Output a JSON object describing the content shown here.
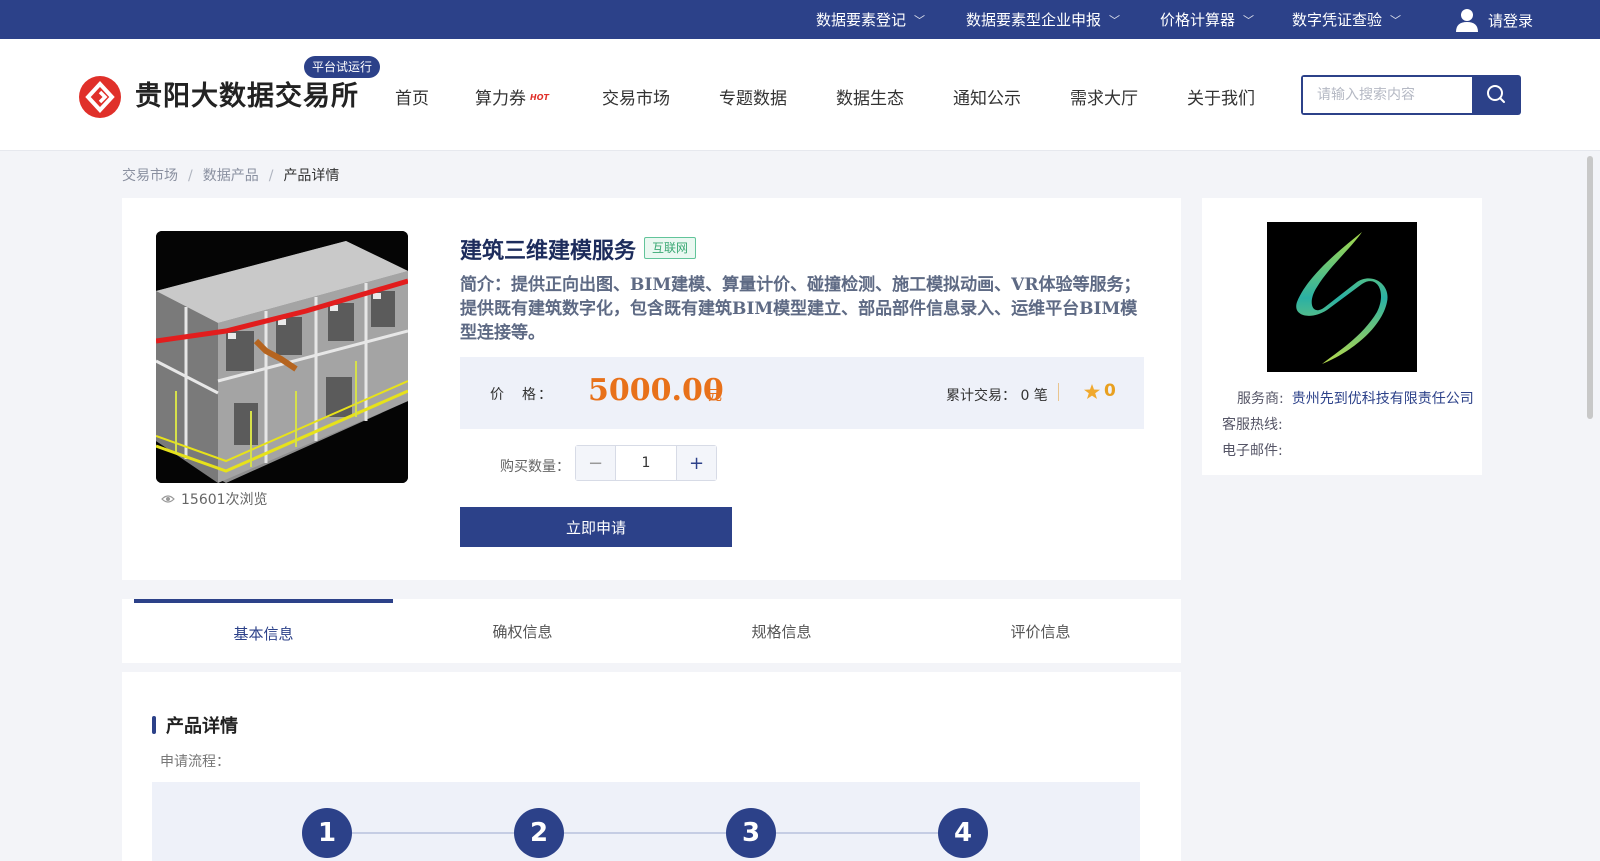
{
  "topbar": {
    "links": [
      {
        "label": "数据要素登记"
      },
      {
        "label": "数据要素型企业申报"
      },
      {
        "label": "价格计算器"
      },
      {
        "label": "数字凭证查验"
      }
    ],
    "login_label": "请登录"
  },
  "header": {
    "logo_text": "贵阳大数据交易所",
    "trial_badge": "平台试运行",
    "nav": [
      "首页",
      "算力券",
      "交易市场",
      "专题数据",
      "数据生态",
      "通知公示",
      "需求大厅",
      "关于我们"
    ],
    "hot_badge": "HOT",
    "search_placeholder": "请输入搜索内容"
  },
  "breadcrumb": [
    "交易市场",
    "数据产品",
    "产品详情"
  ],
  "product": {
    "views": "15601次浏览",
    "title": "建筑三维建模服务",
    "tag": "互联网",
    "intro": "简介：提供正向出图、BIM建模、算量计价、碰撞检测、施工模拟动画、VR体验等服务；提供既有建筑数字化，包含既有建筑BIM模型建立、部品部件信息录入、运维平台BIM模型连接等。",
    "price_label": "价　格：",
    "price": "5000.00",
    "price_unit": "元",
    "trade_label": "累计交易：",
    "trade_count": "0 笔",
    "rating": "0",
    "qty_label": "购买数量：",
    "qty": "1",
    "apply_label": "立即申请"
  },
  "seller": {
    "provider_label": "服务商:",
    "provider": "贵州先到优科技有限责任公司",
    "hotline_label": "客服热线:",
    "email_label": "电子邮件:"
  },
  "tabs": [
    "基本信息",
    "确权信息",
    "规格信息",
    "评价信息"
  ],
  "detail": {
    "section_title": "产品详情",
    "apply_process_label": "申请流程：",
    "steps": [
      "1",
      "2",
      "3",
      "4"
    ]
  },
  "colors": {
    "primary": "#2c4189",
    "price": "#e8711a",
    "tag_green": "#3aa874",
    "logo_red": "#e0302a"
  }
}
